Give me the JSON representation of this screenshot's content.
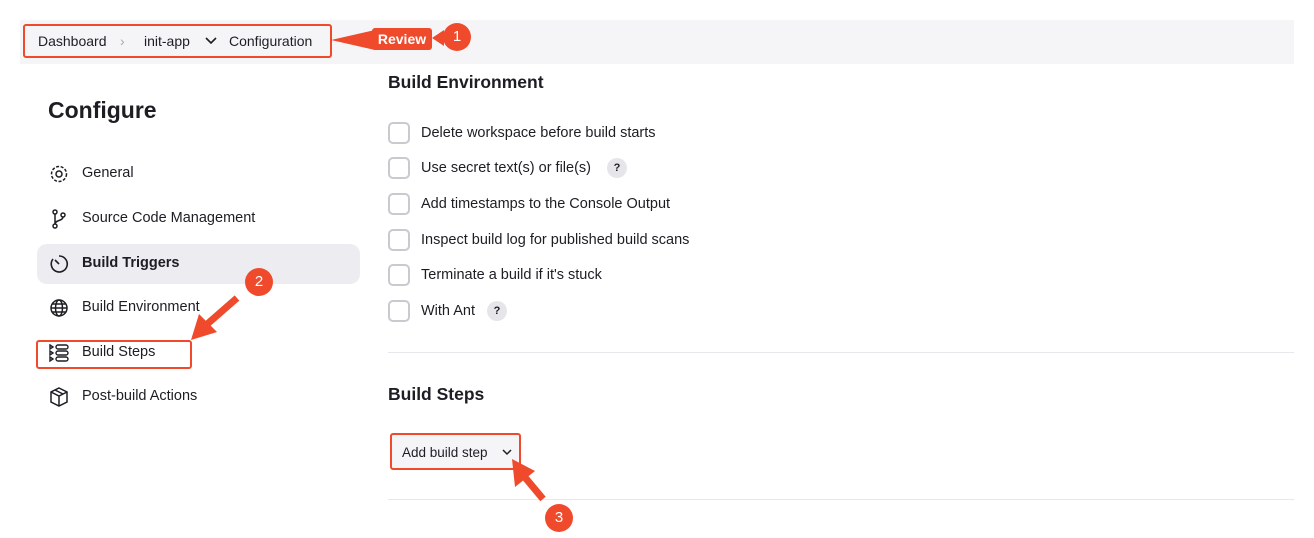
{
  "breadcrumb": {
    "items": [
      "Dashboard",
      "init-app",
      "Configuration"
    ]
  },
  "annotations": {
    "review_label": "Review",
    "step1": "1",
    "step2": "2",
    "step3": "3",
    "color": "#f04a2c"
  },
  "sidebar": {
    "title": "Configure",
    "items": [
      {
        "label": "General",
        "icon": "gear-icon"
      },
      {
        "label": "Source Code Management",
        "icon": "branch-icon"
      },
      {
        "label": "Build Triggers",
        "icon": "timer-icon",
        "selected": true
      },
      {
        "label": "Build Environment",
        "icon": "globe-icon"
      },
      {
        "label": "Build Steps",
        "icon": "list-icon"
      },
      {
        "label": "Post-build Actions",
        "icon": "package-icon"
      }
    ]
  },
  "build_environment": {
    "title": "Build Environment",
    "options": [
      {
        "label": "Delete workspace before build starts",
        "checked": false
      },
      {
        "label": "Use secret text(s) or file(s)",
        "checked": false,
        "help": "?"
      },
      {
        "label": "Add timestamps to the Console Output",
        "checked": false
      },
      {
        "label": "Inspect build log for published build scans",
        "checked": false
      },
      {
        "label": "Terminate a build if it's stuck",
        "checked": false
      },
      {
        "label": "With Ant",
        "checked": false,
        "help": "?"
      }
    ]
  },
  "build_steps": {
    "title": "Build Steps",
    "add_button": "Add build step"
  }
}
